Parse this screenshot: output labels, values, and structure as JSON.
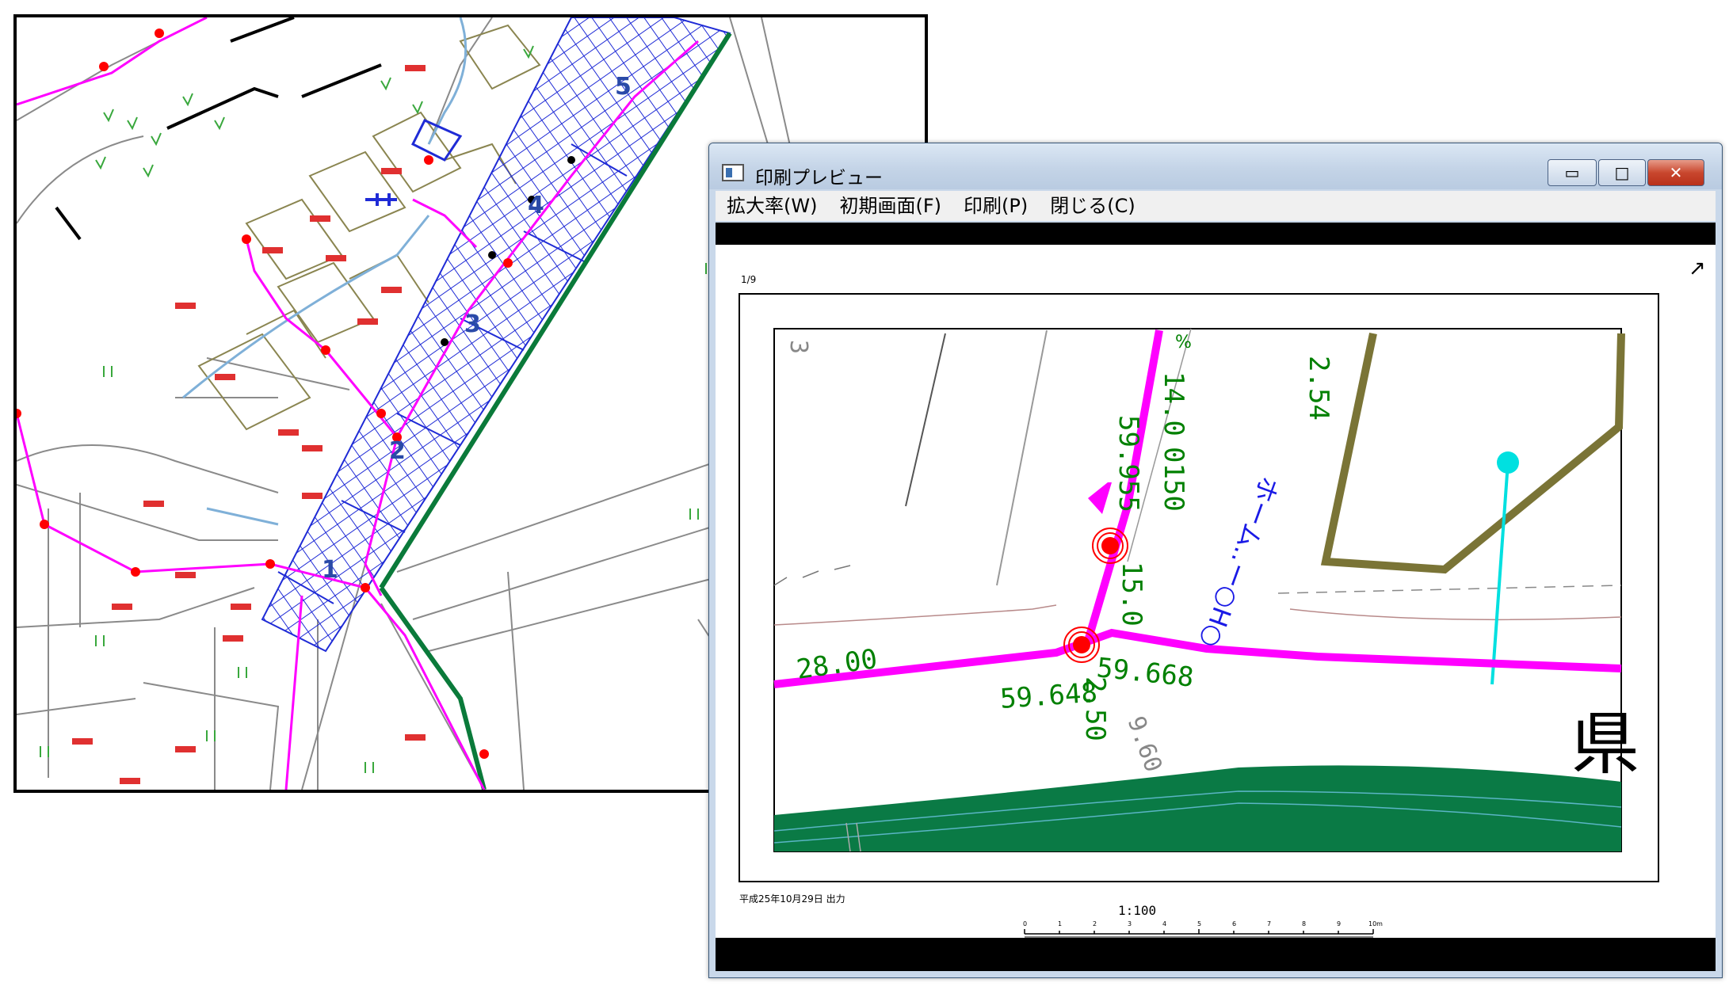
{
  "map_panel": {
    "strip_labels": [
      "1",
      "2",
      "3",
      "4",
      "5"
    ]
  },
  "preview_window": {
    "title": "印刷プレビュー",
    "controls": {
      "minimize": "▭",
      "maximize": "□",
      "close": "✕"
    },
    "menu": [
      "拡大率(W)",
      "初期画面(F)",
      "印刷(P)",
      "閉じる(C)"
    ],
    "page": {
      "page_number": "1/9",
      "north_arrow": "↗",
      "date_label": "平成25年10月29日 出力",
      "scale": "1:100",
      "scale_ticks": [
        "0",
        "1",
        "2",
        "3",
        "4",
        "5",
        "6",
        "7",
        "8",
        "9",
        "10m"
      ],
      "labels": {
        "road_width": "28.00",
        "elev_left": "59.648",
        "elev_right": "59.668",
        "elev_upper": "59.955",
        "pipe_dim_1": "14.0",
        "pipe_dim_2": "0150",
        "pipe_dim_3": "15.0",
        "pipe_dim_4": "2.50",
        "height_a": "2.54",
        "small_3": "3",
        "gray_num": "9.60",
        "blue_code": "ホーム..ー○H○",
        "kanji": "県",
        "percent": "%"
      }
    }
  },
  "colors": {
    "sewer_main": "#ff00ff",
    "manhole": "#ff0000",
    "water_main": "#007a40",
    "dimension": "#008000",
    "grid": "#1f2bd6",
    "cyan_line": "#00e0e0",
    "olive_wall": "#7a7436"
  }
}
